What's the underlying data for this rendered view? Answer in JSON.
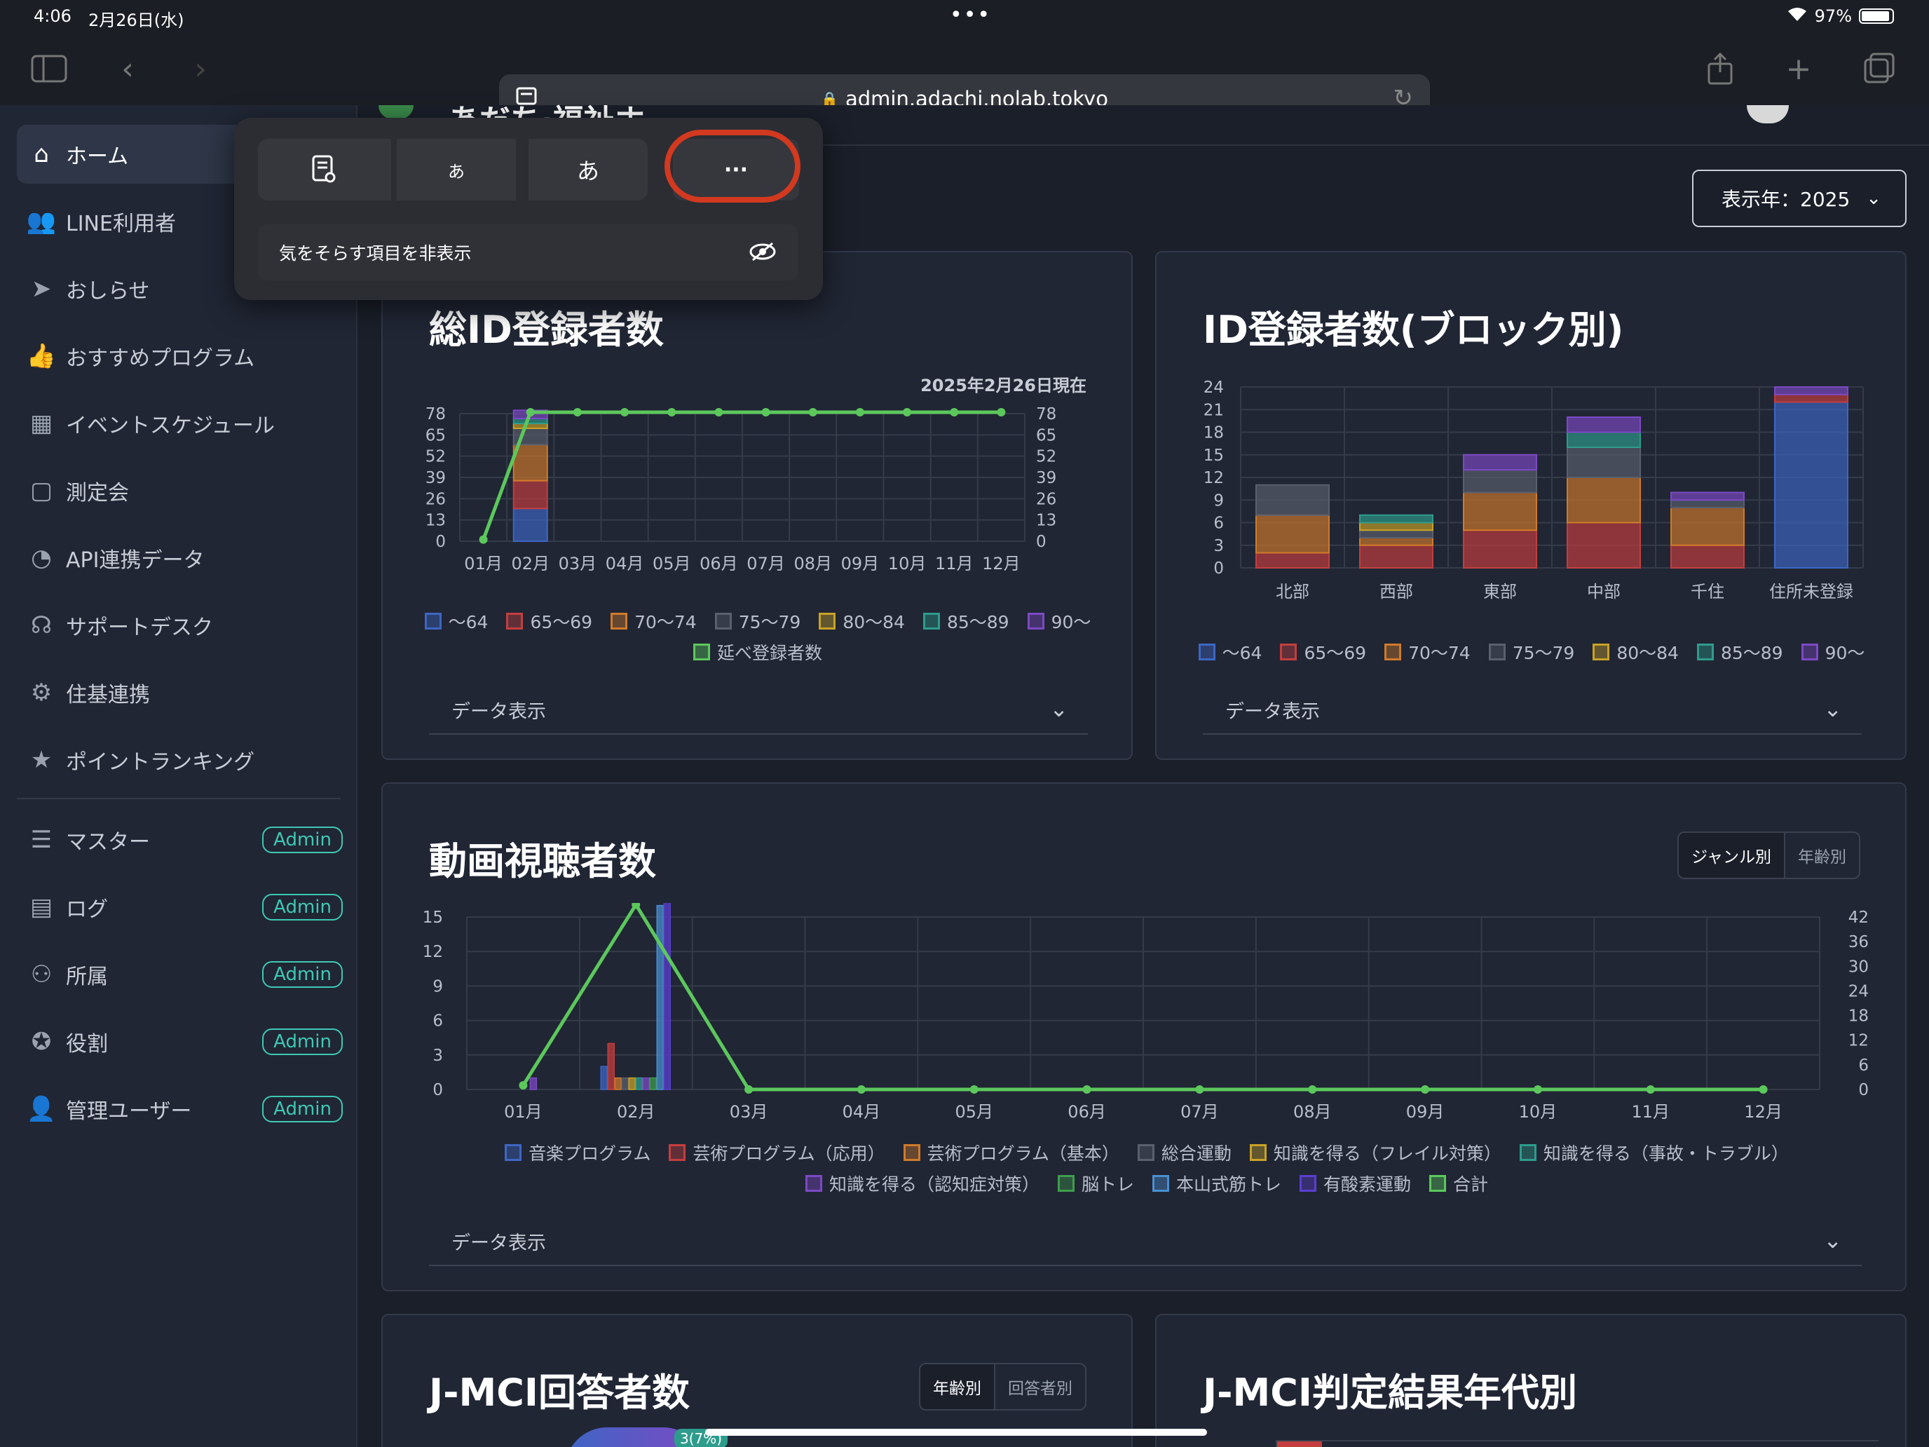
{
  "status": {
    "time": "4:06",
    "date": "2月26日(水)",
    "battery": "97%"
  },
  "browser": {
    "url": "admin.adachi.nolab.tokyo"
  },
  "page": {
    "title_partial": "あだち·福祉ホ"
  },
  "sidebar": {
    "items": [
      {
        "label": "ホーム",
        "icon": "home-icon"
      },
      {
        "label": "LINE利用者",
        "icon": "users-icon"
      },
      {
        "label": "おしらせ",
        "icon": "send-icon"
      },
      {
        "label": "おすすめプログラム",
        "icon": "thumbs-up-icon"
      },
      {
        "label": "イベントスケジュール",
        "icon": "calendar-icon"
      },
      {
        "label": "測定会",
        "icon": "calendar-outline-icon"
      },
      {
        "label": "API連携データ",
        "icon": "api-icon"
      },
      {
        "label": "サポートデスク",
        "icon": "headset-icon"
      },
      {
        "label": "住基連携",
        "icon": "user-gear-icon"
      },
      {
        "label": "ポイントランキング",
        "icon": "star-icon"
      }
    ],
    "admin_items": [
      {
        "label": "マスター",
        "badge": "Admin",
        "icon": "database-icon"
      },
      {
        "label": "ログ",
        "badge": "Admin",
        "icon": "log-icon"
      },
      {
        "label": "所属",
        "badge": "Admin",
        "icon": "sitemap-icon"
      },
      {
        "label": "役割",
        "badge": "Admin",
        "icon": "role-icon"
      },
      {
        "label": "管理ユーザー",
        "badge": "Admin",
        "icon": "admin-user-icon"
      }
    ]
  },
  "popup": {
    "btn_small_a": "あ",
    "btn_large_a": "あ",
    "more": "···",
    "hide_label": "気をそらす項目を非表示"
  },
  "year_select": {
    "label": "表示年：2025"
  },
  "colors": {
    "age": [
      "#3e66c4",
      "#c43e3e",
      "#d07a2a",
      "#5a606d",
      "#c9a227",
      "#2e9c8c",
      "#7c49c4"
    ],
    "line": "#5cc85c"
  },
  "card1": {
    "title": "総ID登録者数",
    "as_of": "2025年2月26日現在",
    "data_toggle": "データ表示"
  },
  "card2": {
    "title": "ID登録者数(ブロック別)",
    "data_toggle": "データ表示"
  },
  "card3": {
    "title": "動画視聴者数",
    "seg": [
      "ジャンル別",
      "年齢別"
    ],
    "data_toggle": "データ表示"
  },
  "card4": {
    "title": "J-MCI回答者数",
    "seg": [
      "年齢別",
      "回答者別"
    ],
    "pie_label": "3(7%)"
  },
  "card5": {
    "title": "J-MCI判定結果年代別"
  },
  "chart_data": [
    {
      "type": "bar",
      "title": "総ID登録者数",
      "categories": [
        "01月",
        "02月",
        "03月",
        "04月",
        "05月",
        "06月",
        "07月",
        "08月",
        "09月",
        "10月",
        "11月",
        "12月"
      ],
      "ylim": [
        0,
        78
      ],
      "yticks": [
        0,
        13,
        26,
        39,
        52,
        65,
        78
      ],
      "legend": [
        "〜64",
        "65〜69",
        "70〜74",
        "75〜79",
        "80〜84",
        "85〜89",
        "90〜",
        "延べ登録者数"
      ],
      "series": [
        {
          "name": "〜64",
          "values": [
            0,
            20,
            0,
            0,
            0,
            0,
            0,
            0,
            0,
            0,
            0,
            0
          ]
        },
        {
          "name": "65〜69",
          "values": [
            0,
            17,
            0,
            0,
            0,
            0,
            0,
            0,
            0,
            0,
            0,
            0
          ]
        },
        {
          "name": "70〜74",
          "values": [
            0,
            22,
            0,
            0,
            0,
            0,
            0,
            0,
            0,
            0,
            0,
            0
          ]
        },
        {
          "name": "75〜79",
          "values": [
            0,
            10,
            0,
            0,
            0,
            0,
            0,
            0,
            0,
            0,
            0,
            0
          ]
        },
        {
          "name": "80〜84",
          "values": [
            0,
            3,
            0,
            0,
            0,
            0,
            0,
            0,
            0,
            0,
            0,
            0
          ]
        },
        {
          "name": "85〜89",
          "values": [
            0,
            3,
            0,
            0,
            0,
            0,
            0,
            0,
            0,
            0,
            0,
            0
          ]
        },
        {
          "name": "90〜",
          "values": [
            0,
            5,
            0,
            0,
            0,
            0,
            0,
            0,
            0,
            0,
            0,
            0
          ]
        },
        {
          "name": "延べ登録者数",
          "type": "line",
          "values": [
            1,
            80,
            80,
            80,
            80,
            80,
            80,
            80,
            80,
            80,
            80,
            80
          ]
        }
      ]
    },
    {
      "type": "bar",
      "title": "ID登録者数(ブロック別)",
      "categories": [
        "北部",
        "西部",
        "東部",
        "中部",
        "千住",
        "住所未登録"
      ],
      "ylim": [
        0,
        24
      ],
      "yticks": [
        0,
        3,
        6,
        9,
        12,
        15,
        18,
        21,
        24
      ],
      "legend": [
        "〜64",
        "65〜69",
        "70〜74",
        "75〜79",
        "80〜84",
        "85〜89",
        "90〜"
      ],
      "series": [
        {
          "name": "〜64",
          "values": [
            0,
            0,
            0,
            0,
            0,
            22
          ]
        },
        {
          "name": "65〜69",
          "values": [
            2,
            3,
            5,
            6,
            3,
            1
          ]
        },
        {
          "name": "70〜74",
          "values": [
            5,
            1,
            5,
            6,
            5,
            0
          ]
        },
        {
          "name": "75〜79",
          "values": [
            4,
            1,
            3,
            4,
            1,
            0
          ]
        },
        {
          "name": "80〜84",
          "values": [
            0,
            1,
            0,
            0,
            0,
            0
          ]
        },
        {
          "name": "85〜89",
          "values": [
            0,
            1,
            0,
            2,
            0,
            0
          ]
        },
        {
          "name": "90〜",
          "values": [
            0,
            0,
            2,
            2,
            1,
            1
          ]
        }
      ]
    },
    {
      "type": "bar",
      "title": "動画視聴者数",
      "categories": [
        "01月",
        "02月",
        "03月",
        "04月",
        "05月",
        "06月",
        "07月",
        "08月",
        "09月",
        "10月",
        "11月",
        "12月"
      ],
      "ylim": [
        0,
        15
      ],
      "yticks": [
        0,
        3,
        6,
        9,
        12,
        15
      ],
      "y2ticks": [
        0,
        6,
        12,
        18,
        24,
        30,
        36,
        42
      ],
      "legend": [
        "音楽プログラム",
        "芸術プログラム（応用）",
        "芸術プログラム（基本）",
        "総合運動",
        "知識を得る（フレイル対策）",
        "知識を得る（事故・トラブル）",
        "知識を得る（認知症対策）",
        "脳トレ",
        "本山式筋トレ",
        "有酸素運動",
        "合計"
      ],
      "series": [
        {
          "name": "音楽プログラム",
          "values": [
            0,
            2,
            0,
            0,
            0,
            0,
            0,
            0,
            0,
            0,
            0,
            0
          ]
        },
        {
          "name": "芸術プログラム（応用）",
          "values": [
            0,
            4,
            0,
            0,
            0,
            0,
            0,
            0,
            0,
            0,
            0,
            0
          ]
        },
        {
          "name": "芸術プログラム（基本）",
          "values": [
            0,
            1,
            0,
            0,
            0,
            0,
            0,
            0,
            0,
            0,
            0,
            0
          ]
        },
        {
          "name": "総合運動",
          "values": [
            0,
            1,
            0,
            0,
            0,
            0,
            0,
            0,
            0,
            0,
            0,
            0
          ]
        },
        {
          "name": "知識を得る（フレイル対策）",
          "values": [
            0,
            1,
            0,
            0,
            0,
            0,
            0,
            0,
            0,
            0,
            0,
            0
          ]
        },
        {
          "name": "知識を得る（事故・トラブル）",
          "values": [
            0,
            1,
            0,
            0,
            0,
            0,
            0,
            0,
            0,
            0,
            0,
            0
          ]
        },
        {
          "name": "知識を得る（認知症対策）",
          "values": [
            1,
            1,
            0,
            0,
            0,
            0,
            0,
            0,
            0,
            0,
            0,
            0
          ]
        },
        {
          "name": "脳トレ",
          "values": [
            0,
            1,
            0,
            0,
            0,
            0,
            0,
            0,
            0,
            0,
            0,
            0
          ]
        },
        {
          "name": "本山式筋トレ",
          "values": [
            0,
            16,
            0,
            0,
            0,
            0,
            0,
            0,
            0,
            0,
            0,
            0
          ]
        },
        {
          "name": "有酸素運動",
          "values": [
            0,
            17,
            0,
            0,
            0,
            0,
            0,
            0,
            0,
            0,
            0,
            0
          ]
        },
        {
          "name": "合計",
          "type": "line",
          "axis": "y2",
          "values": [
            1,
            45,
            0,
            0,
            0,
            0,
            0,
            0,
            0,
            0,
            0,
            0
          ]
        }
      ]
    }
  ]
}
